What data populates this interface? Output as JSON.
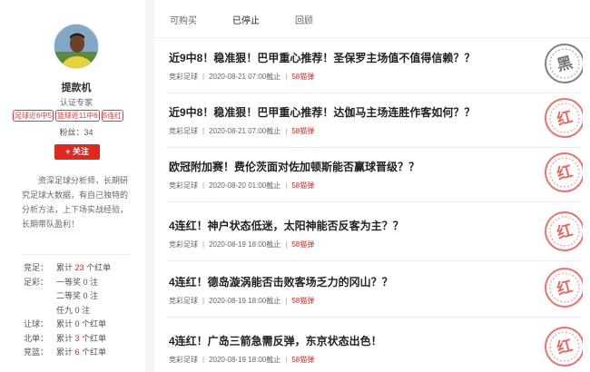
{
  "expert": {
    "name": "提款机",
    "title": "认证专家",
    "tags": [
      "足球近6中5",
      "篮球近11中6",
      "5连红"
    ],
    "fans_label": "粉丝：",
    "fans_count": "34",
    "follow_label": "+ 关注",
    "description": "资深足球分析师，长期研究足球大数据，有自己独特的分析方法，上下场实战经验，长期带队盈利！"
  },
  "stats": [
    {
      "category": "竞足：",
      "prefix": "累计",
      "value": "23",
      "suffix": "个红单",
      "highlight": true
    },
    {
      "category": "足彩：",
      "prefix": "一等奖",
      "value": "0",
      "suffix": "注",
      "highlight": false
    },
    {
      "category": "",
      "prefix": "二等奖",
      "value": "0",
      "suffix": "注",
      "highlight": false
    },
    {
      "category": "",
      "prefix": "任九",
      "value": "0",
      "suffix": "注",
      "highlight": false
    },
    {
      "category": "让球：",
      "prefix": "累计",
      "value": "0",
      "suffix": "个红单",
      "highlight": false
    },
    {
      "category": "北单：",
      "prefix": "累计",
      "value": "3",
      "suffix": "个红单",
      "highlight": true
    },
    {
      "category": "竞篮：",
      "prefix": "累计",
      "value": "6",
      "suffix": "个红单",
      "highlight": true
    }
  ],
  "tabs": [
    "可购买",
    "已停止",
    "回顾"
  ],
  "active_tab": 1,
  "articles": [
    {
      "title": "近9中8！稳准狠！巴甲重心推荐！圣保罗主场值不值得信赖？？",
      "category": "竞彩足球",
      "datetime": "2020-08-21 07:00截止",
      "count": "58猫弹",
      "stamp": "黑"
    },
    {
      "title": "近9中8！稳准狠！巴甲重心推荐！达伽马主场连胜作客如何？？",
      "category": "竞彩足球",
      "datetime": "2020-08-21 07:00截止",
      "count": "58猫弹",
      "stamp": "红"
    },
    {
      "title": "欧冠附加赛！费伦茨面对佐加顿斯能否赢球晋级？？",
      "category": "竞彩足球",
      "datetime": "2020-08-20 01:00截止",
      "count": "58猫弹",
      "stamp": "红"
    },
    {
      "title": "4连红！神户状态低迷，太阳神能否反客为主？？",
      "category": "竞彩足球",
      "datetime": "2020-08-19 18:00截止",
      "count": "58猫弹",
      "stamp": "红"
    },
    {
      "title": "4连红！德岛漩涡能否击败客场乏力的冈山？？",
      "category": "竞彩足球",
      "datetime": "2020-08-19 18:00截止",
      "count": "58猫弹",
      "stamp": "红"
    },
    {
      "title": "4连红！广岛三箭急需反弹，东京状态出色！",
      "category": "竞彩足球",
      "datetime": "2020-08-19 18:00截止",
      "count": "58猫弹",
      "stamp": "红"
    }
  ],
  "colors": {
    "accent": "#e0281f",
    "stamp_red": "#e6433a",
    "stamp_black": "#555555"
  }
}
